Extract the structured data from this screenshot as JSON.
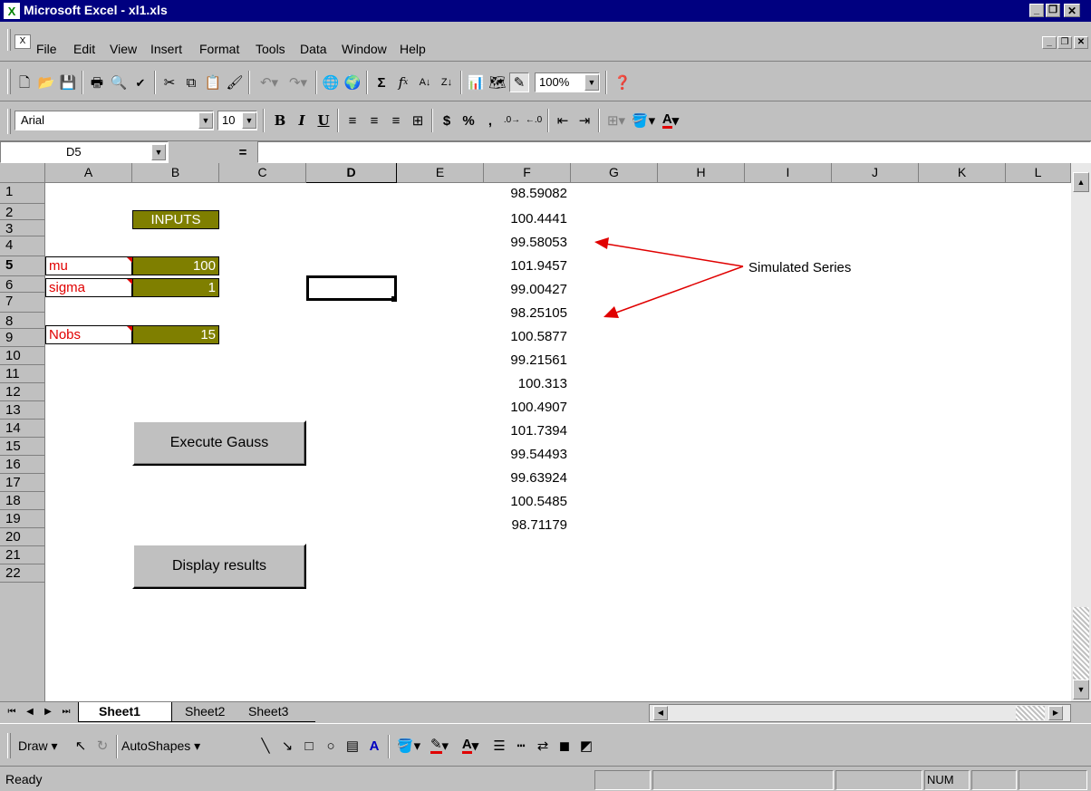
{
  "window": {
    "title": "Microsoft Excel - xl1.xls"
  },
  "menu": [
    "File",
    "Edit",
    "View",
    "Insert",
    "Format",
    "Tools",
    "Data",
    "Window",
    "Help"
  ],
  "toolbar": {
    "zoom": "100%"
  },
  "format": {
    "font": "Arial",
    "size": "10",
    "bold": "B",
    "italic": "I",
    "underline": "U",
    "currency": "$",
    "percent": "%",
    "comma": ","
  },
  "formula": {
    "namebox": "D5",
    "equals": "="
  },
  "columns": [
    "A",
    "B",
    "C",
    "D",
    "E",
    "F",
    "G",
    "H",
    "I",
    "J",
    "K",
    "L"
  ],
  "rows": [
    "1",
    "2",
    "3",
    "4",
    "5",
    "6",
    "7",
    "8",
    "9",
    "10",
    "11",
    "12",
    "13",
    "14",
    "15",
    "16",
    "17",
    "18",
    "19",
    "20",
    "21",
    "22"
  ],
  "inputs": {
    "header": "INPUTS",
    "mu_label": "mu",
    "mu_value": "100",
    "sigma_label": "sigma",
    "sigma_value": "1",
    "nobs_label": "Nobs",
    "nobs_value": "15"
  },
  "series": [
    "98.59082",
    "100.4441",
    "99.58053",
    "101.9457",
    "99.00427",
    "98.25105",
    "100.5877",
    "99.21561",
    "100.313",
    "100.4907",
    "101.7394",
    "99.54493",
    "99.63924",
    "100.5485",
    "98.71179"
  ],
  "annotation": "Simulated Series",
  "buttons": {
    "execute": "Execute Gauss",
    "display": "Display results"
  },
  "sheets": [
    "Sheet1",
    "Sheet2",
    "Sheet3"
  ],
  "drawing": {
    "draw": "Draw",
    "autoshapes": "AutoShapes"
  },
  "status": {
    "ready": "Ready",
    "num": "NUM"
  },
  "colors": {
    "titlebar": "#000080",
    "olive": "#7f7f00",
    "red": "#e00000"
  }
}
